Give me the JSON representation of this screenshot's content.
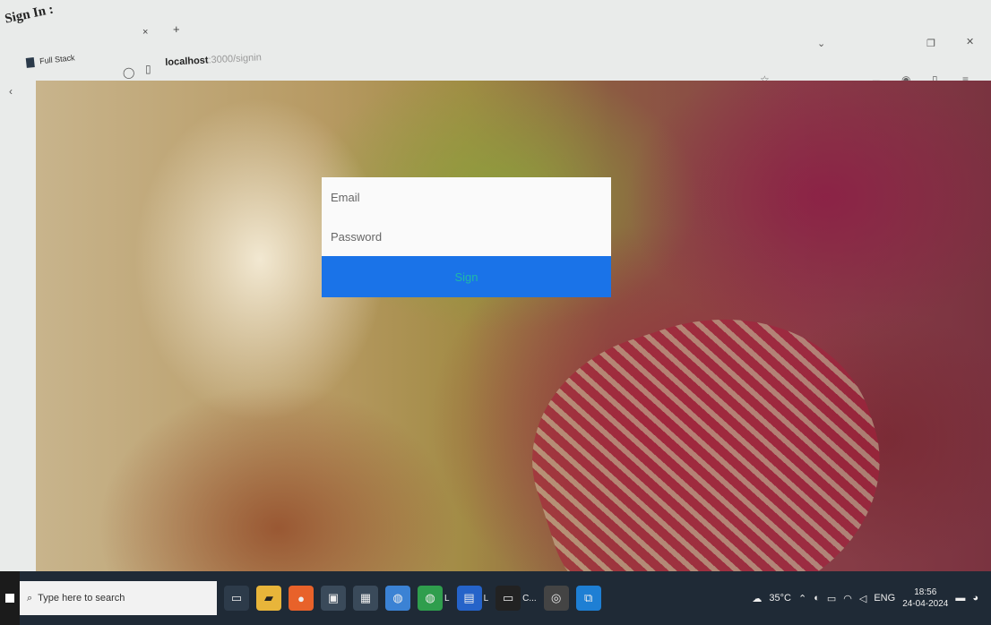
{
  "document": {
    "heading": "Sign In :"
  },
  "browser": {
    "tab": {
      "title": "Full Stack"
    },
    "tab_close": "×",
    "new_tab": "+",
    "url_host": "localhost",
    "url_path": ":3000/signin"
  },
  "form": {
    "email_placeholder": "Email",
    "password_placeholder": "Password",
    "submit_label": "Sign"
  },
  "taskbar": {
    "search_placeholder": "Type here to search",
    "apps": [
      {
        "label": "L"
      },
      {
        "label": "L"
      },
      {
        "label": "C..."
      }
    ],
    "weather": "35°C",
    "language": "ENG",
    "time": "18:56",
    "date": "24-04-2024"
  },
  "colors": {
    "sign_button": "#1a73e8",
    "sign_text": "#1fb8a8",
    "taskbar": "#1f2a36"
  }
}
